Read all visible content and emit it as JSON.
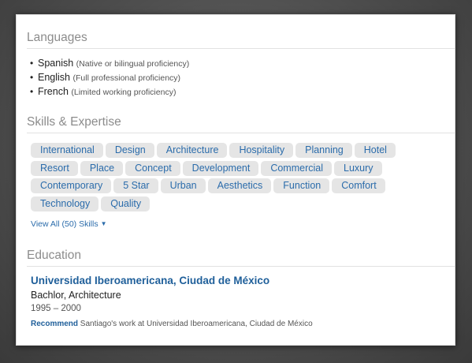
{
  "languages": {
    "heading": "Languages",
    "items": [
      {
        "name": "Spanish",
        "level": "(Native or bilingual proficiency)"
      },
      {
        "name": "English",
        "level": "(Full professional proficiency)"
      },
      {
        "name": "French",
        "level": "(Limited working proficiency)"
      }
    ]
  },
  "skills": {
    "heading": "Skills & Expertise",
    "items": [
      "International",
      "Design",
      "Architecture",
      "Hospitality",
      "Planning",
      "Hotel",
      "Resort",
      "Place",
      "Concept",
      "Development",
      "Commercial",
      "Luxury",
      "Contemporary",
      "5 Star",
      "Urban",
      "Aesthetics",
      "Function",
      "Comfort",
      "Technology",
      "Quality"
    ],
    "view_all_label": "View All (50) Skills",
    "view_all_caret": "▼"
  },
  "education": {
    "heading": "Education",
    "school": "Universidad Iberoamericana, Ciudad de México",
    "degree": "Bachlor, Architecture",
    "years": "1995 – 2000",
    "recommend_link": "Recommend",
    "recommend_text": "Santiago's work at Universidad Iberoamericana, Ciudad de México"
  },
  "colors": {
    "link": "#2b6cab",
    "skill_pill": "#e5e5e5",
    "heading": "#8c8c8c"
  }
}
